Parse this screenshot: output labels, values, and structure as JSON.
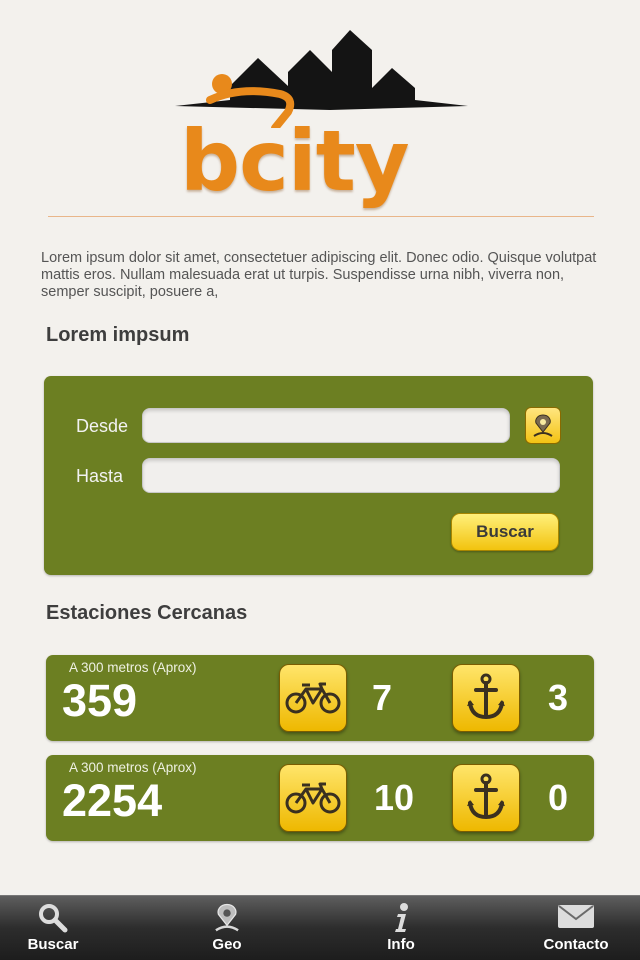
{
  "logo": {
    "text": "bcity",
    "brand_color": "#e8891b"
  },
  "intro": "Lorem ipsum dolor sit amet, consectetuer adipiscing elit. Donec odio. Quisque volutpat mattis eros. Nullam malesuada erat ut turpis. Suspendisse urna nibh, viverra non, semper suscipit, posuere a,",
  "search": {
    "title": "Lorem impsum",
    "from_label": "Desde",
    "from_value": "",
    "to_label": "Hasta",
    "to_value": "",
    "submit_label": "Buscar",
    "geo_icon": "map-pin-icon"
  },
  "stations": {
    "title": "Estaciones Cercanas",
    "items": [
      {
        "distance": "A 300 metros (Aprox)",
        "id": "359",
        "bikes": "7",
        "docks": "3"
      },
      {
        "distance": "A 300 metros (Aprox)",
        "id": "2254",
        "bikes": "10",
        "docks": "0"
      }
    ]
  },
  "tabbar": {
    "tabs": [
      {
        "label": "Buscar",
        "icon": "magnifier-icon"
      },
      {
        "label": "Geo",
        "icon": "map-pin-icon"
      },
      {
        "label": "Info",
        "icon": "info-icon"
      },
      {
        "label": "Contacto",
        "icon": "envelope-icon"
      }
    ]
  },
  "colors": {
    "panel": "#6c7f22",
    "button": "#f2c30e",
    "background": "#f3f1ed"
  }
}
